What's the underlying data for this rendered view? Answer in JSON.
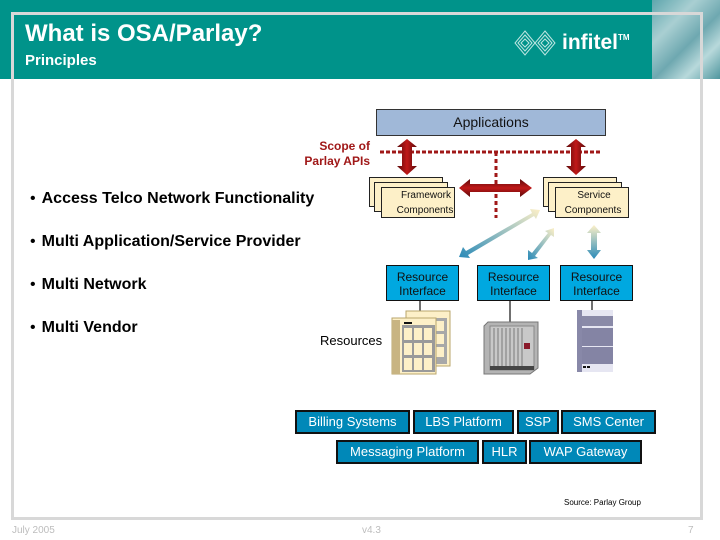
{
  "header": {
    "title": "What is OSA/Parlay?",
    "subtitle": "Principles",
    "logo_text": "infitel",
    "logo_tm": "TM",
    "background_color": "#00938a"
  },
  "bullets": [
    "Access Telco Network Functionality",
    "Multi Application/Service Provider",
    "Multi Network",
    "Multi Vendor"
  ],
  "bullet_glyph": "•",
  "diagram": {
    "applications_label": "Applications",
    "scope_label_line1": "Scope of",
    "scope_label_line2": "Parlay APIs",
    "framework": {
      "line1": "Framework",
      "line2": "Components"
    },
    "service": {
      "line1": "Service",
      "line2": "Components"
    },
    "resource_interfaces": [
      {
        "line1": "Resource",
        "line2": "Interface"
      },
      {
        "line1": "Resource",
        "line2": "Interface"
      },
      {
        "line1": "Resource",
        "line2": "Interface"
      }
    ],
    "resources_label": "Resources",
    "resource_icons": [
      "database-stack-icon",
      "telecom-rack-icon",
      "server-cabinet-icon"
    ],
    "resource_buttons_row1": [
      "Billing Systems",
      "LBS Platform",
      "SSP",
      "SMS Center"
    ],
    "resource_buttons_row2": [
      "Messaging Platform",
      "HLR",
      "WAP Gateway"
    ],
    "colors": {
      "applications": "#a0b8d8",
      "scope": "#a01818",
      "components": "#fdf0c8",
      "resource_interface": "#00a8e0",
      "resource_button": "#0088b8"
    }
  },
  "source": "Source: Parlay Group",
  "footer": {
    "date": "July 2005",
    "version": "v4.3",
    "page": "7"
  }
}
